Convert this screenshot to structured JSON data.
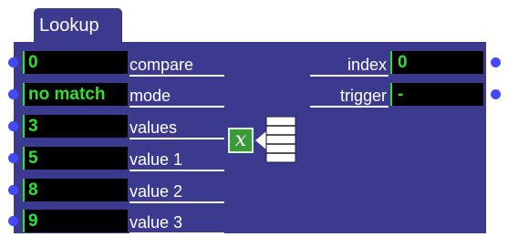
{
  "module": {
    "title": "Lookup"
  },
  "inputs": [
    {
      "value": "0",
      "label": "compare"
    },
    {
      "value": "no match",
      "label": "mode"
    },
    {
      "value": "3",
      "label": "values"
    },
    {
      "value": "5",
      "label": "value 1"
    },
    {
      "value": "8",
      "label": "value 2"
    },
    {
      "value": "9",
      "label": "value 3"
    }
  ],
  "outputs": [
    {
      "label": "index",
      "value": "0"
    },
    {
      "label": "trigger",
      "value": "-"
    }
  ],
  "icon": {
    "name": "function-x-icon",
    "glyph": "x"
  },
  "colors": {
    "panel": "#3c3a8f",
    "port": "#4448ff",
    "value_text": "#2fe02f",
    "field_bg": "#000000"
  }
}
